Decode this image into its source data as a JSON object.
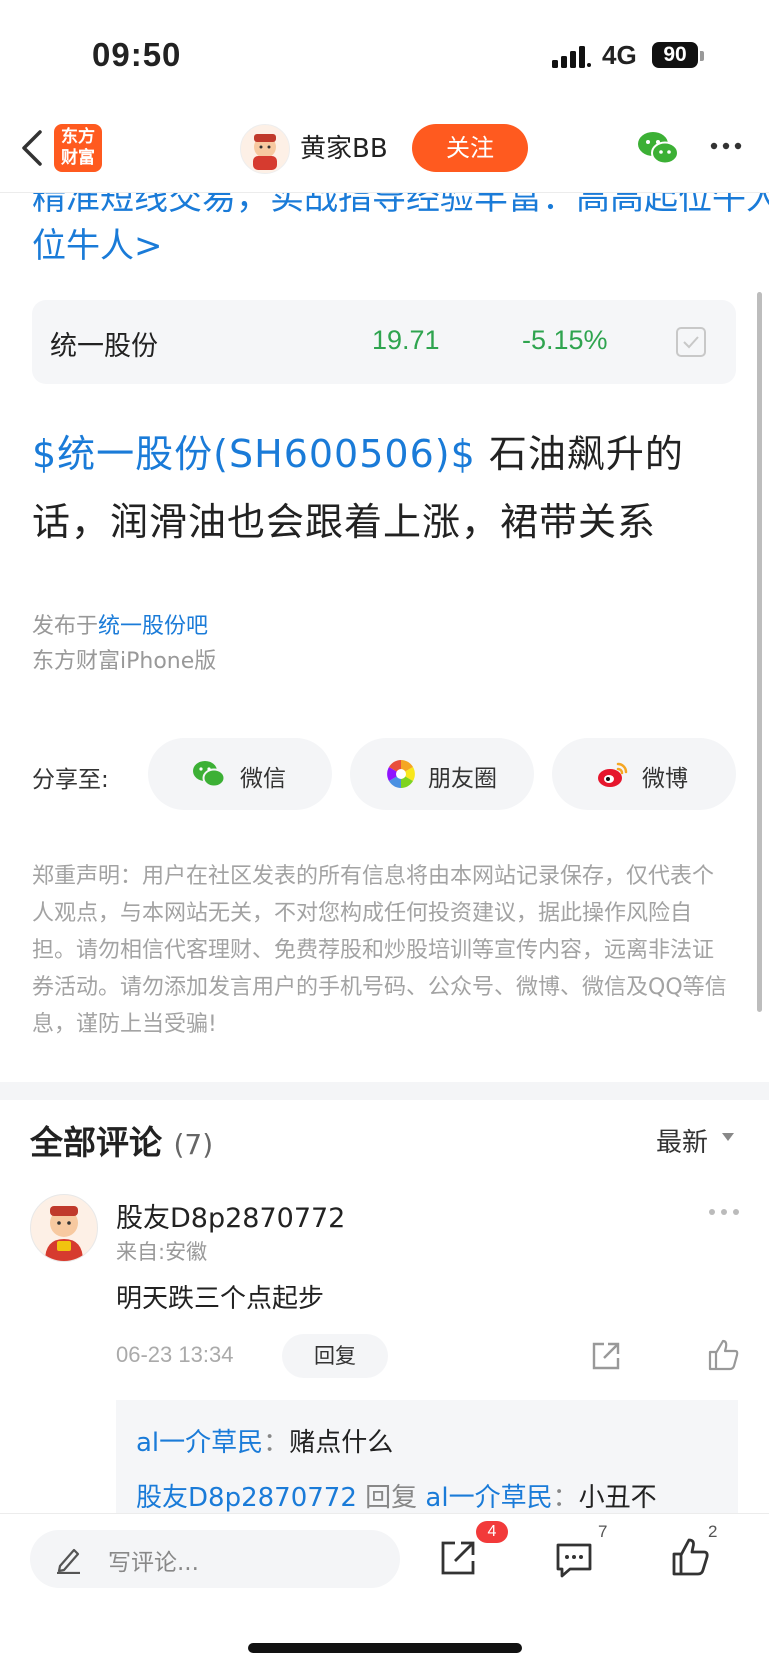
{
  "status": {
    "time": "09:50",
    "network": "4G",
    "battery": "90"
  },
  "nav": {
    "logo_line1": "东方",
    "logo_line2": "财富",
    "username": "黄家BB",
    "follow_label": "关注"
  },
  "header_cut_text": "精准短线交易，实战指导经验丰富：高高起位牛人",
  "header_link": "位牛人>",
  "stock": {
    "name": "统一股份",
    "price": "19.71",
    "change": "-5.15%",
    "color_down": "#2fa44f"
  },
  "post": {
    "tag": "$统一股份(SH600506)$",
    "body": "  石油飙升的话，润滑油也会跟着上涨，裙带关系"
  },
  "meta": {
    "published_prefix": "发布于",
    "forum": "统一股份吧",
    "client": "东方财富iPhone版"
  },
  "share": {
    "label": "分享至:",
    "wechat": "微信",
    "moments": "朋友圈",
    "weibo": "微博"
  },
  "disclaimer": "郑重声明：用户在社区发表的所有信息将由本网站记录保存，仅代表个人观点，与本网站无关，不对您构成任何投资建议，据此操作风险自担。请勿相信代客理财、免费荐股和炒股培训等宣传内容，远离非法证券活动。请勿添加发言用户的手机号码、公众号、微博、微信及QQ等信息，谨防上当受骗!",
  "comments": {
    "title": "全部评论",
    "count": "(7)",
    "sort": "最新",
    "items": [
      {
        "user": "股友D8p2870772",
        "from": "来自:安徽",
        "text": "明天跌三个点起步",
        "time": "06-23 13:34",
        "reply_label": "回复",
        "replies": [
          {
            "user": "al一介草民",
            "sep": "：",
            "text": "赌点什么"
          },
          {
            "user": "股友D8p2870772",
            "mid": " 回复 ",
            "target": "al一介草民",
            "sep": "：",
            "text": "小丑不"
          }
        ]
      }
    ]
  },
  "bottom": {
    "placeholder": "写评论...",
    "share_badge": "4",
    "comment_count": "7",
    "like_count": "2"
  },
  "colors": {
    "accent": "#ff5a1f",
    "link": "#1a7bd8",
    "green": "#2fa44f"
  }
}
